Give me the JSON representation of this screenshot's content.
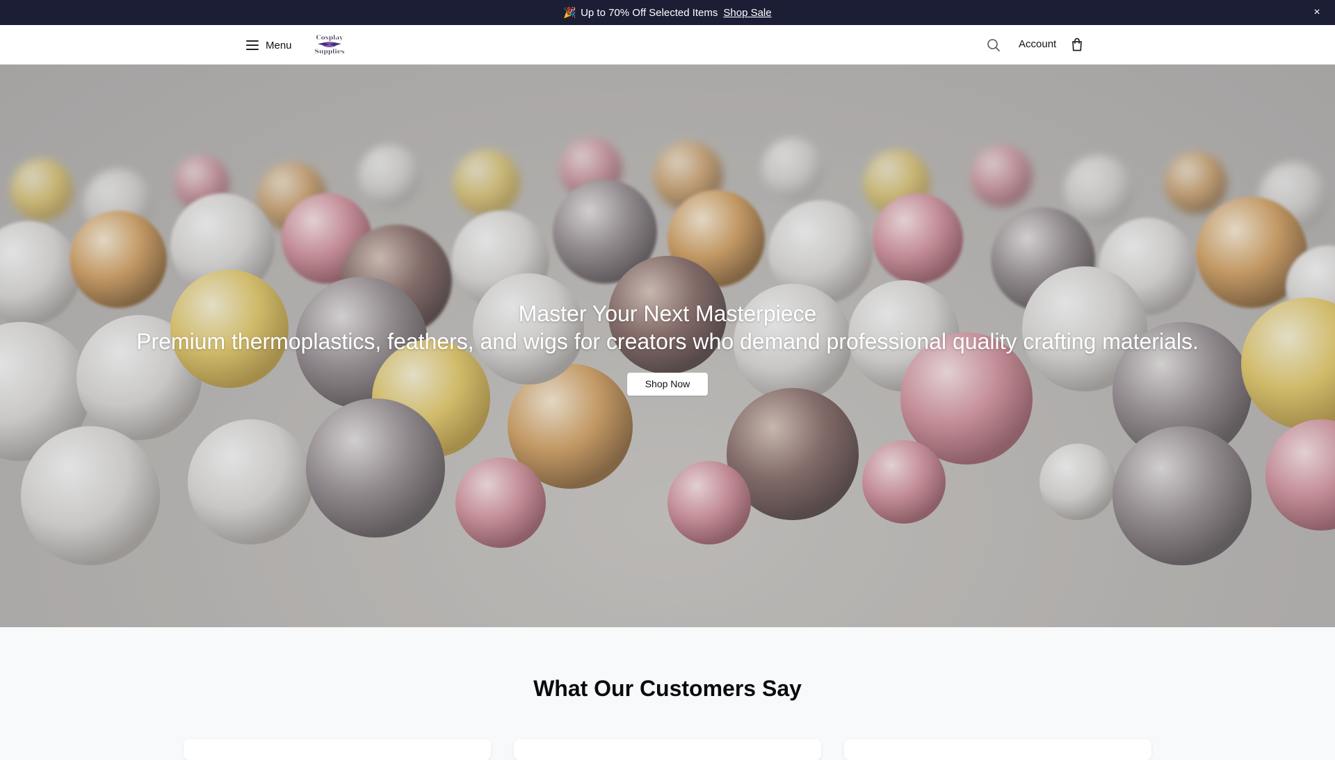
{
  "announcement": {
    "emoji": "🎉",
    "text": "Up to 70% Off Selected Items",
    "link_label": "Shop Sale",
    "close_glyph": "×"
  },
  "header": {
    "menu_label": "Menu",
    "logo_icon": "cosplay-supplies-logo",
    "search_icon": "search-icon",
    "account_label": "Account",
    "cart_icon": "shopping-bag-icon"
  },
  "hero": {
    "title": "Master Your Next Masterpiece",
    "subtitle": "Premium thermoplastics, feathers, and wigs for creators who demand professional quality crafting materials.",
    "cta_label": "Shop Now"
  },
  "testimonials": {
    "heading": "What Our Customers Say",
    "card_count_visible": 3
  },
  "colors": {
    "announcement_bg": "#1b1e35",
    "header_bg": "#ffffff",
    "section_bg": "#f8f9fb"
  }
}
